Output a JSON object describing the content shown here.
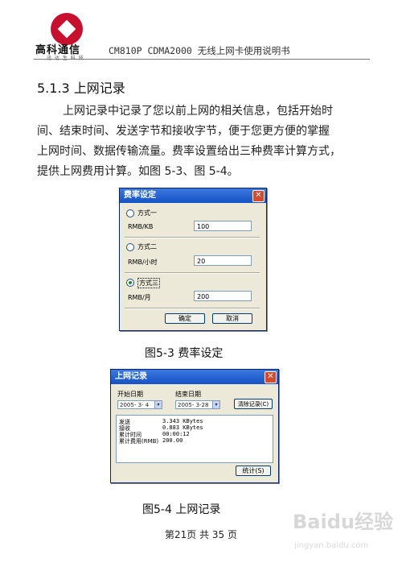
{
  "header": {
    "company_name": "高科通信",
    "company_tagline": "迅 达 生 科 技",
    "doc_title": "CM810P CDMA2000 无线上网卡使用说明书"
  },
  "section": {
    "heading": "5.1.3  上网记录",
    "paragraph_lines": [
      "上网记录中记录了您以前上网的相关信息，包括开始时",
      "间、结束时间、发送字节和接收字节，便于您更方便的掌握",
      "上网时间、数据传输流量。费率设置给出三种费率计算方式，",
      "提供上网费用计算。如图 5-3、图 5-4。"
    ]
  },
  "rate_dialog": {
    "title": "费率设定",
    "options": [
      {
        "label": "方式一",
        "unit": "RMB/KB",
        "value": "100",
        "checked": false
      },
      {
        "label": "方式二",
        "unit": "RMB/小时",
        "value": "20",
        "checked": false
      },
      {
        "label": "方式三",
        "unit": "RMB/月",
        "value": "200",
        "checked": true
      }
    ],
    "ok_label": "确定",
    "cancel_label": "取消",
    "caption": "图5-3      费率设定"
  },
  "log_dialog": {
    "title": "上网记录",
    "start_date_label": "开始日期",
    "end_date_label": "结束日期",
    "start_date": "2005- 3- 4",
    "end_date": "2005- 3-28",
    "clear_label": "清除记录(C)",
    "stats_label": "统计(S)",
    "rows": [
      {
        "label": "发送",
        "value": "3.343  KBytes"
      },
      {
        "label": "接收",
        "value": "0.883  KBytes"
      },
      {
        "label": "累计时间",
        "value": "00:00:12"
      },
      {
        "label": "累计费用(RMB)",
        "value": "200.00"
      }
    ],
    "caption": "图5-4      上网记录"
  },
  "footer": {
    "page_number": "第21页 共 35 页"
  },
  "watermark": {
    "brand": "Baidu经验",
    "url": "jingyan.baidu.com"
  }
}
